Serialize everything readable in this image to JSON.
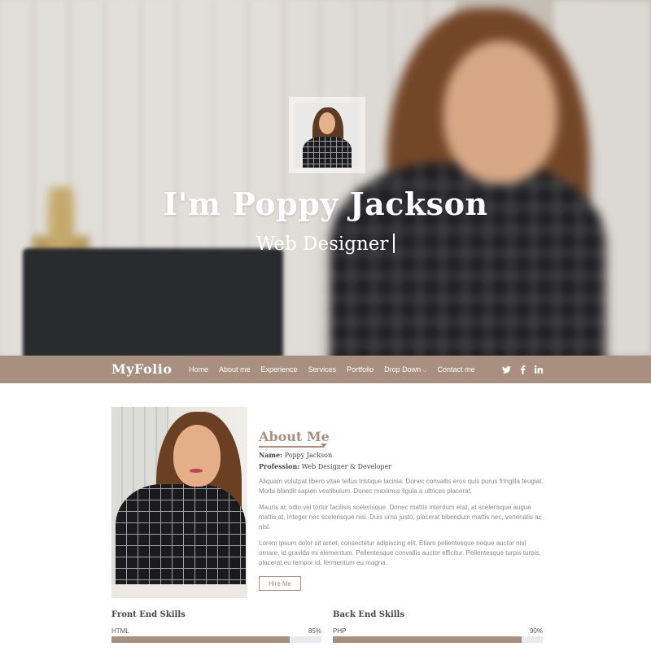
{
  "hero": {
    "name_title": "I'm Poppy Jackson",
    "subtitle": "Web Designer"
  },
  "navbar": {
    "brand": "MyFolio",
    "links": [
      "Home",
      "About me",
      "Experience",
      "Services",
      "Portfolio",
      "Drop Down",
      "Contact me"
    ],
    "social_icons": [
      "twitter-icon",
      "facebook-icon",
      "linkedin-icon"
    ]
  },
  "about": {
    "title": "About Me",
    "name_label": "Name:",
    "name_value": "Poppy Jackson",
    "profession_label": "Profession:",
    "profession_value": "Web Designer & Developer",
    "paragraphs": [
      "Aliquam volutpat libero vitae tellus tristique lacinia. Donec convallis eros quis purus fringilla feugiat. Morbi blandit sapien vestibulum. Donec maximus ligula a ultrices placerat.",
      "Mauris ac odio vel tortor facilisis scelerisque. Donec mattis interdum erat, at scelerisque augue mattis at. Integer nec scelerisque nisl. Duis urna justo, placerat bibendum mattis nec, venenatis ac nisl.",
      "Lorem ipsum dolor sit amet, consectetur adipiscing elit. Etiam pellentesque neque auctor nisl ornare, id gravida mi elementum. Pellentesque convallis auctor efficitur. Pellentesque turpis turpis, placerat eu tempor id, fermentum eu magna."
    ],
    "hire_button": "Hire Me"
  },
  "skills": {
    "front_end": {
      "heading": "Front End Skills",
      "items": [
        {
          "name": "HTML",
          "percent_label": "85%",
          "level": 0.85
        }
      ]
    },
    "back_end": {
      "heading": "Back End Skills",
      "items": [
        {
          "name": "PHP",
          "percent_label": "90%",
          "level": 0.9
        }
      ]
    }
  },
  "colors": {
    "accent": "#a88f80",
    "track": "#e7eaee"
  }
}
